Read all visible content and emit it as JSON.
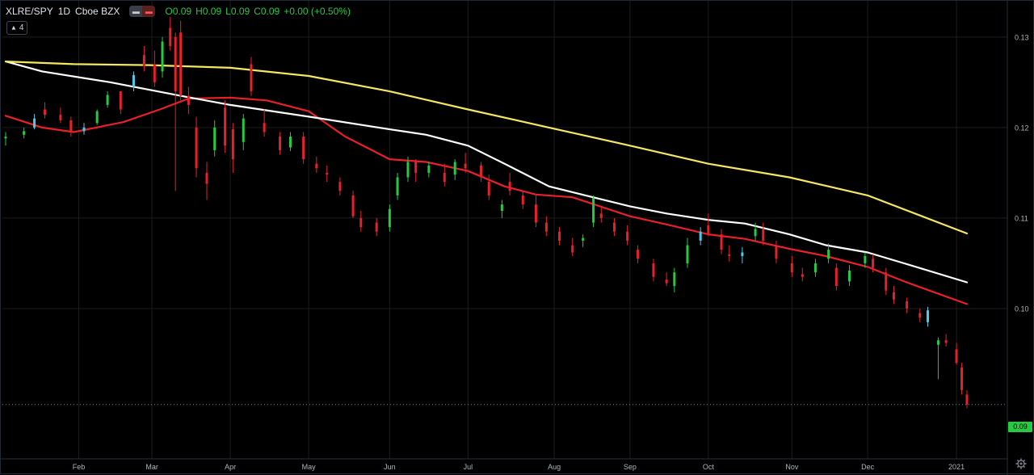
{
  "header": {
    "symbol": "XLRE/SPY",
    "interval": "1D",
    "exchange": "Cboe BZX",
    "ohlc": {
      "o": "0.09",
      "h": "0.09",
      "l": "0.09",
      "c": "0.09",
      "change": "+0.00 (+0.50%)"
    },
    "ohlc_labels": {
      "o": "O",
      "h": "H",
      "l": "L",
      "c": "C"
    }
  },
  "indicator_toggle": {
    "count": "4",
    "icon": "chevron-up-icon"
  },
  "colors": {
    "background": "#000000",
    "up": "#26c940",
    "up_alt": "#4ec9e8",
    "down": "#e8202a",
    "ma_fast": "#e8202a",
    "ma_mid": "#ffffff",
    "ma_slow": "#f5e663",
    "grid": "#1c1c1c",
    "last_price": "#26c940"
  },
  "chart_data": {
    "type": "candlestick",
    "title": "",
    "xlabel": "",
    "ylabel": "",
    "ylim": [
      0.0834,
      0.134
    ],
    "y_ticks": [
      "0.13",
      "0.12",
      "0.11",
      "0.10"
    ],
    "x_ticks": [
      "Feb",
      "Mar",
      "Apr",
      "May",
      "Jun",
      "Jul",
      "Aug",
      "Sep",
      "Oct",
      "Nov",
      "Dec",
      "2021"
    ],
    "x_range": [
      "2020-01-06",
      "2021-01-08"
    ],
    "grid": true,
    "last_price": {
      "value": 0.0894,
      "label": "0.09"
    },
    "series": [
      {
        "type": "moving-average",
        "color": "#e8202a",
        "points": [
          [
            "2020-01-06",
            0.1213
          ],
          [
            "2020-01-20",
            0.12
          ],
          [
            "2020-02-01",
            0.1195
          ],
          [
            "2020-02-20",
            0.1206
          ],
          [
            "2020-03-05",
            0.122
          ],
          [
            "2020-03-16",
            0.1232
          ],
          [
            "2020-04-01",
            0.1233
          ],
          [
            "2020-04-15",
            0.123
          ],
          [
            "2020-05-01",
            0.1218
          ],
          [
            "2020-05-15",
            0.119
          ],
          [
            "2020-06-01",
            0.1165
          ],
          [
            "2020-06-15",
            0.1162
          ],
          [
            "2020-07-01",
            0.1152
          ],
          [
            "2020-07-15",
            0.1135
          ],
          [
            "2020-07-27",
            0.1126
          ],
          [
            "2020-08-10",
            0.1123
          ],
          [
            "2020-09-01",
            0.1102
          ],
          [
            "2020-09-15",
            0.1093
          ],
          [
            "2020-10-01",
            0.1082
          ],
          [
            "2020-10-15",
            0.1077
          ],
          [
            "2020-11-01",
            0.1066
          ],
          [
            "2020-11-15",
            0.1058
          ],
          [
            "2020-12-01",
            0.1046
          ],
          [
            "2020-12-15",
            0.103
          ],
          [
            "2021-01-08",
            0.1005
          ]
        ]
      },
      {
        "type": "moving-average",
        "color": "#ffffff",
        "points": [
          [
            "2020-01-06",
            0.1273
          ],
          [
            "2020-01-20",
            0.1262
          ],
          [
            "2020-02-15",
            0.125
          ],
          [
            "2020-03-15",
            0.1234
          ],
          [
            "2020-04-01",
            0.1225
          ],
          [
            "2020-05-01",
            0.1212
          ],
          [
            "2020-06-01",
            0.1198
          ],
          [
            "2020-06-15",
            0.1192
          ],
          [
            "2020-07-01",
            0.118
          ],
          [
            "2020-07-15",
            0.116
          ],
          [
            "2020-08-01",
            0.1135
          ],
          [
            "2020-08-15",
            0.1125
          ],
          [
            "2020-09-01",
            0.1113
          ],
          [
            "2020-09-15",
            0.1105
          ],
          [
            "2020-10-01",
            0.1098
          ],
          [
            "2020-10-15",
            0.1094
          ],
          [
            "2020-11-01",
            0.1082
          ],
          [
            "2020-11-15",
            0.107
          ],
          [
            "2020-12-01",
            0.1062
          ],
          [
            "2020-12-15",
            0.105
          ],
          [
            "2021-01-08",
            0.1029
          ]
        ]
      },
      {
        "type": "moving-average",
        "color": "#f5e663",
        "points": [
          [
            "2020-01-06",
            0.1273
          ],
          [
            "2020-02-01",
            0.127
          ],
          [
            "2020-03-01",
            0.1269
          ],
          [
            "2020-04-01",
            0.1266
          ],
          [
            "2020-05-01",
            0.1257
          ],
          [
            "2020-06-01",
            0.124
          ],
          [
            "2020-07-01",
            0.122
          ],
          [
            "2020-08-01",
            0.12
          ],
          [
            "2020-09-01",
            0.118
          ],
          [
            "2020-10-01",
            0.116
          ],
          [
            "2020-11-01",
            0.1145
          ],
          [
            "2020-12-01",
            0.1125
          ],
          [
            "2021-01-08",
            0.1083
          ]
        ]
      }
    ],
    "candles": [
      [
        "2020-01-06",
        0.1188,
        0.1195,
        0.118,
        0.119
      ],
      [
        "2020-01-13",
        0.1192,
        0.12,
        0.1188,
        0.1196
      ],
      [
        "2020-01-17",
        0.12,
        0.1215,
        0.1198,
        0.121
      ],
      [
        "2020-01-21",
        0.122,
        0.1228,
        0.121,
        0.1214
      ],
      [
        "2020-01-27",
        0.1214,
        0.1222,
        0.1205,
        0.1208
      ],
      [
        "2020-01-31",
        0.1208,
        0.1212,
        0.119,
        0.1195
      ],
      [
        "2020-02-05",
        0.1196,
        0.1205,
        0.1192,
        0.12
      ],
      [
        "2020-02-10",
        0.1205,
        0.122,
        0.1203,
        0.1218
      ],
      [
        "2020-02-14",
        0.1225,
        0.124,
        0.1222,
        0.1236
      ],
      [
        "2020-02-19",
        0.124,
        0.1238,
        0.1215,
        0.122
      ],
      [
        "2020-02-24",
        0.1245,
        0.1262,
        0.124,
        0.1258
      ],
      [
        "2020-02-28",
        0.128,
        0.129,
        0.1262,
        0.1268
      ],
      [
        "2020-03-03",
        0.127,
        0.1285,
        0.1245,
        0.125
      ],
      [
        "2020-03-06",
        0.1262,
        0.13,
        0.1255,
        0.1295
      ],
      [
        "2020-03-09",
        0.131,
        0.1322,
        0.1285,
        0.129
      ],
      [
        "2020-03-11",
        0.13,
        0.1305,
        0.113,
        0.124
      ],
      [
        "2020-03-13",
        0.1305,
        0.1318,
        0.123,
        0.1235
      ],
      [
        "2020-03-16",
        0.1235,
        0.1245,
        0.1215,
        0.1225
      ],
      [
        "2020-03-19",
        0.12,
        0.1212,
        0.1145,
        0.1155
      ],
      [
        "2020-03-23",
        0.115,
        0.1162,
        0.112,
        0.1138
      ],
      [
        "2020-03-26",
        0.1175,
        0.1208,
        0.1168,
        0.12
      ],
      [
        "2020-03-30",
        0.1222,
        0.123,
        0.1172,
        0.118
      ],
      [
        "2020-04-02",
        0.1198,
        0.1205,
        0.115,
        0.1165
      ],
      [
        "2020-04-06",
        0.1184,
        0.1215,
        0.1175,
        0.121
      ],
      [
        "2020-04-09",
        0.127,
        0.1278,
        0.1235,
        0.124
      ],
      [
        "2020-04-14",
        0.1205,
        0.122,
        0.119,
        0.1195
      ],
      [
        "2020-04-20",
        0.119,
        0.1195,
        0.117,
        0.1175
      ],
      [
        "2020-04-24",
        0.1178,
        0.1195,
        0.1174,
        0.119
      ],
      [
        "2020-04-29",
        0.119,
        0.1195,
        0.116,
        0.1165
      ],
      [
        "2020-05-04",
        0.116,
        0.1168,
        0.115,
        0.1155
      ],
      [
        "2020-05-08",
        0.115,
        0.1158,
        0.114,
        0.1148
      ],
      [
        "2020-05-13",
        0.114,
        0.1145,
        0.1125,
        0.113
      ],
      [
        "2020-05-18",
        0.1125,
        0.113,
        0.11,
        0.1102
      ],
      [
        "2020-05-21",
        0.11,
        0.1108,
        0.1085,
        0.109
      ],
      [
        "2020-05-27",
        0.1095,
        0.11,
        0.108,
        0.1085
      ],
      [
        "2020-06-01",
        0.109,
        0.1115,
        0.1085,
        0.111
      ],
      [
        "2020-06-04",
        0.1125,
        0.115,
        0.112,
        0.1145
      ],
      [
        "2020-06-08",
        0.1145,
        0.1168,
        0.114,
        0.1162
      ],
      [
        "2020-06-11",
        0.1162,
        0.1165,
        0.114,
        0.115
      ],
      [
        "2020-06-16",
        0.115,
        0.1162,
        0.1145,
        0.1158
      ],
      [
        "2020-06-22",
        0.115,
        0.116,
        0.1135,
        0.114
      ],
      [
        "2020-06-26",
        0.1148,
        0.1165,
        0.1142,
        0.1162
      ],
      [
        "2020-06-30",
        0.116,
        0.1172,
        0.115,
        0.1155
      ],
      [
        "2020-07-06",
        0.1158,
        0.1162,
        0.114,
        0.1145
      ],
      [
        "2020-07-09",
        0.114,
        0.1148,
        0.112,
        0.1125
      ],
      [
        "2020-07-14",
        0.1108,
        0.112,
        0.11,
        0.1115
      ],
      [
        "2020-07-17",
        0.114,
        0.115,
        0.1125,
        0.113
      ],
      [
        "2020-07-22",
        0.1125,
        0.113,
        0.111,
        0.1115
      ],
      [
        "2020-07-27",
        0.1115,
        0.1125,
        0.109,
        0.1095
      ],
      [
        "2020-07-31",
        0.1095,
        0.1102,
        0.108,
        0.1085
      ],
      [
        "2020-08-05",
        0.1085,
        0.109,
        0.107,
        0.1075
      ],
      [
        "2020-08-10",
        0.107,
        0.1078,
        0.1058,
        0.1062
      ],
      [
        "2020-08-14",
        0.1075,
        0.1082,
        0.1068,
        0.1078
      ],
      [
        "2020-08-18",
        0.1095,
        0.1125,
        0.109,
        0.1122
      ],
      [
        "2020-08-21",
        0.1105,
        0.1112,
        0.1095,
        0.11
      ],
      [
        "2020-08-26",
        0.1095,
        0.11,
        0.108,
        0.1085
      ],
      [
        "2020-08-31",
        0.1085,
        0.1092,
        0.107,
        0.1075
      ],
      [
        "2020-09-04",
        0.1065,
        0.107,
        0.105,
        0.1055
      ],
      [
        "2020-09-10",
        0.105,
        0.1055,
        0.103,
        0.1035
      ],
      [
        "2020-09-15",
        0.1032,
        0.104,
        0.1025,
        0.1028
      ],
      [
        "2020-09-18",
        0.1025,
        0.1045,
        0.1018,
        0.104
      ],
      [
        "2020-09-23",
        0.105,
        0.1078,
        0.1045,
        0.107
      ],
      [
        "2020-09-28",
        0.1075,
        0.109,
        0.107,
        0.1085
      ],
      [
        "2020-10-01",
        0.1092,
        0.1105,
        0.108,
        0.1082
      ],
      [
        "2020-10-06",
        0.1082,
        0.1088,
        0.106,
        0.1065
      ],
      [
        "2020-10-09",
        0.106,
        0.107,
        0.1052,
        0.1058
      ],
      [
        "2020-10-14",
        0.1058,
        0.1068,
        0.105,
        0.1062
      ],
      [
        "2020-10-19",
        0.108,
        0.1095,
        0.1075,
        0.1088
      ],
      [
        "2020-10-22",
        0.1088,
        0.1095,
        0.107,
        0.1075
      ],
      [
        "2020-10-27",
        0.107,
        0.1075,
        0.105,
        0.1055
      ],
      [
        "2020-11-02",
        0.105,
        0.1058,
        0.1035,
        0.104
      ],
      [
        "2020-11-06",
        0.1038,
        0.1045,
        0.103,
        0.1035
      ],
      [
        "2020-11-11",
        0.104,
        0.1055,
        0.1035,
        0.105
      ],
      [
        "2020-11-16",
        0.1055,
        0.1072,
        0.105,
        0.1065
      ],
      [
        "2020-11-19",
        0.1045,
        0.105,
        0.102,
        0.1025
      ],
      [
        "2020-11-24",
        0.103,
        0.1048,
        0.1025,
        0.1042
      ],
      [
        "2020-11-30",
        0.105,
        0.1062,
        0.1045,
        0.1058
      ],
      [
        "2020-12-03",
        0.1055,
        0.106,
        0.104,
        0.1045
      ],
      [
        "2020-12-08",
        0.104,
        0.1045,
        0.1015,
        0.102
      ],
      [
        "2020-12-11",
        0.1018,
        0.1025,
        0.1005,
        0.101
      ],
      [
        "2020-12-16",
        0.1008,
        0.1012,
        0.0995,
        0.1
      ],
      [
        "2020-12-21",
        0.0995,
        0.1,
        0.0985,
        0.099
      ],
      [
        "2020-12-24",
        0.0985,
        0.1002,
        0.098,
        0.0998
      ],
      [
        "2020-12-28",
        0.096,
        0.0968,
        0.0922,
        0.0965
      ],
      [
        "2020-12-31",
        0.0965,
        0.0972,
        0.0958,
        0.0962
      ],
      [
        "2021-01-04",
        0.0955,
        0.0962,
        0.0938,
        0.094
      ],
      [
        "2021-01-06",
        0.0935,
        0.094,
        0.0905,
        0.091
      ],
      [
        "2021-01-08",
        0.0905,
        0.091,
        0.089,
        0.0894
      ]
    ]
  }
}
